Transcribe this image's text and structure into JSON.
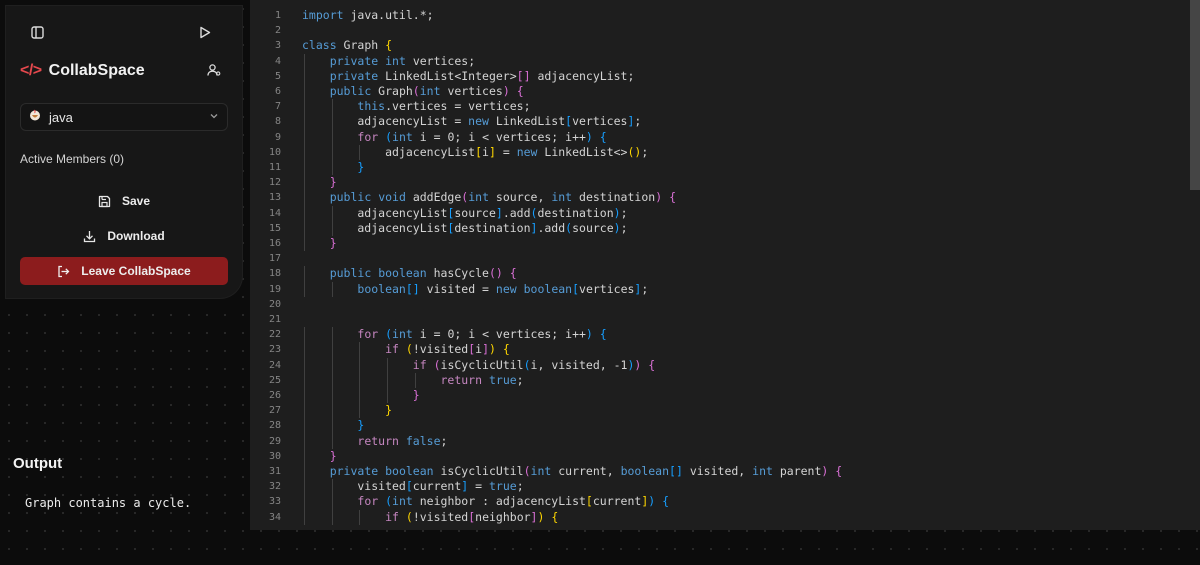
{
  "sidebar": {
    "brand": {
      "code_symbol": "</>",
      "name": "CollabSpace"
    },
    "language": {
      "selected": "java"
    },
    "members": {
      "label": "Active Members (0)"
    },
    "actions": {
      "save": "Save",
      "download": "Download",
      "leave": "Leave CollabSpace"
    }
  },
  "output": {
    "title": "Output",
    "text": "Graph contains a cycle."
  },
  "editor": {
    "code_lines": [
      "import java.util.*;",
      "",
      "class Graph {",
      "    private int vertices;",
      "    private LinkedList<Integer>[] adjacencyList;",
      "    public Graph(int vertices) {",
      "        this.vertices = vertices;",
      "        adjacencyList = new LinkedList[vertices];",
      "        for (int i = 0; i < vertices; i++) {",
      "            adjacencyList[i] = new LinkedList<>();",
      "        }",
      "    }",
      "    public void addEdge(int source, int destination) {",
      "        adjacencyList[source].add(destination);",
      "        adjacencyList[destination].add(source);",
      "    }",
      "",
      "    public boolean hasCycle() {",
      "        boolean[] visited = new boolean[vertices];",
      "",
      "",
      "        for (int i = 0; i < vertices; i++) {",
      "            if (!visited[i]) {",
      "                if (isCyclicUtil(i, visited, -1)) {",
      "                    return true;",
      "                }",
      "            }",
      "        }",
      "        return false;",
      "    }",
      "    private boolean isCyclicUtil(int current, boolean[] visited, int parent) {",
      "        visited[current] = true;",
      "        for (int neighbor : adjacencyList[current]) {",
      "            if (!visited[neighbor]) {"
    ]
  },
  "colors": {
    "accent_red": "#e5484d",
    "leave_button": "#8c1c1d",
    "keyword": "#569cd6",
    "control": "#c586c0",
    "bracket_1": "#ffd700",
    "bracket_2": "#da70d6",
    "bracket_3": "#179fff"
  },
  "icons": {
    "sidebar_toggle": "panel-left-icon",
    "run": "play-icon",
    "users": "users-icon",
    "language": "java-cup-icon",
    "dropdown": "chevron-down-icon",
    "save": "save-icon",
    "download": "download-icon",
    "leave": "log-out-icon"
  }
}
